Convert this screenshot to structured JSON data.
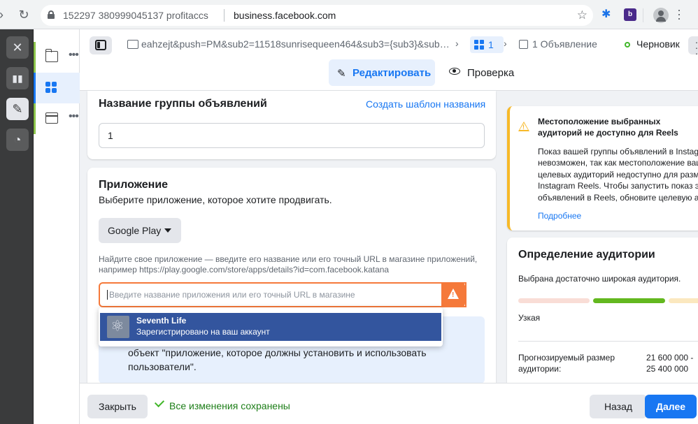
{
  "browser": {
    "site_info": "152297 380999045137 profitaccs",
    "domain": "business.facebook.com"
  },
  "header": {
    "breadcrumb_campaign": "eahzejt&push=PM&sub2=11518sunrisequeen464&sub3={sub3}&sub…",
    "breadcrumb_adset_count": "1",
    "breadcrumb_ad": "1 Объявление",
    "status": "Черновик",
    "tab_edit": "Редактировать",
    "tab_review": "Проверка"
  },
  "adset_name": {
    "title": "Название группы объявлений",
    "template_link": "Создать шаблон названия",
    "value": "1"
  },
  "app": {
    "title": "Приложение",
    "subtitle": "Выберите приложение, которое хотите продвигать.",
    "store": "Google Play",
    "hint": "Найдите свое приложение — введите его название или его точный URL в магазине приложений, например https://play.google.com/store/apps/details?id=com.facebook.katana",
    "search_placeholder": "Введите название приложения или его точный URL в магазине",
    "info_text": "объект \"приложение, которое должны установить и использовать пользователи\".",
    "dropdown_item": {
      "title": "Seventh Life",
      "subtitle": "Зарегистрировано на ваш аккаунт"
    }
  },
  "alert": {
    "title": "Местоположение выбранных аудиторий не доступно для Reels",
    "body": "Показ вашей группы объявлений в Instag\nневозможен, так как местоположение ваш\nцелевых аудиторий недоступно для разм\nInstagram Reels. Чтобы запустить показ э\nобъявлений в Reels, обновите целевую ау",
    "link": "Подробнее"
  },
  "audience": {
    "title": "Определение аудитории",
    "description": "Выбрана достаточно широкая аудитория.",
    "narrow_label": "Узкая",
    "size_label": "Прогнозируемый размер аудитории:",
    "size_value": "21 600 000 -\n25 400 000",
    "colors": {
      "narrow": "#f9ddd6",
      "ok": "#63b81f",
      "broad": "#fbe8bf"
    }
  },
  "footer": {
    "close": "Закрыть",
    "saved": "Все изменения сохранены",
    "back": "Назад",
    "next": "Далее"
  },
  "colors": {
    "accent": "#1877f2",
    "warning": "#f5793a",
    "alert": "#f7b928",
    "success": "#42b72a"
  }
}
